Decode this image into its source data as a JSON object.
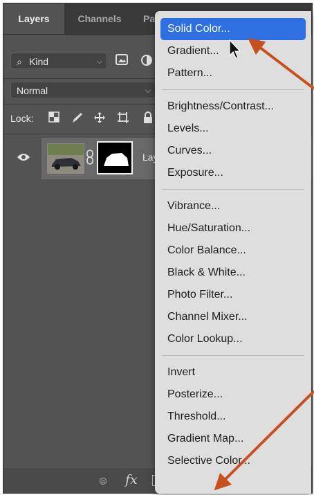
{
  "tabs": [
    "Layers",
    "Channels",
    "Pa"
  ],
  "filter": {
    "kind_label": "Kind"
  },
  "blend": {
    "mode": "Normal"
  },
  "lock": {
    "label": "Lock:"
  },
  "layer": {
    "name_partial": "Lay"
  },
  "bottom": {
    "fx_label": "fx"
  },
  "menu": {
    "groups": [
      [
        "Solid Color...",
        "Gradient...",
        "Pattern..."
      ],
      [
        "Brightness/Contrast...",
        "Levels...",
        "Curves...",
        "Exposure..."
      ],
      [
        "Vibrance...",
        "Hue/Saturation...",
        "Color Balance...",
        "Black & White...",
        "Photo Filter...",
        "Channel Mixer...",
        "Color Lookup..."
      ],
      [
        "Invert",
        "Posterize...",
        "Threshold...",
        "Gradient Map...",
        "Selective Color..."
      ]
    ],
    "highlighted": "Solid Color..."
  },
  "colors": {
    "panel": "#535353",
    "menu_bg": "#dedede",
    "menu_highlight": "#2d6fe0",
    "annotation_arrow": "#c8501e"
  }
}
